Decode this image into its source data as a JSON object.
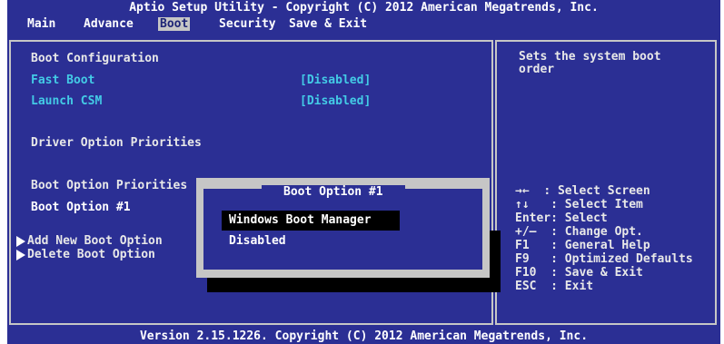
{
  "header": {
    "title": "Aptio Setup Utility - Copyright (C) 2012 American Megatrends, Inc.",
    "tabs": [
      "Main",
      "Advance",
      "Boot",
      "Security",
      "Save & Exit"
    ],
    "active_tab": "Boot"
  },
  "left_panel": {
    "boot_configuration": "Boot Configuration",
    "fast_boot": {
      "label": "Fast Boot",
      "value": "[Disabled]"
    },
    "launch_csm": {
      "label": "Launch CSM",
      "value": "[Disabled]"
    },
    "driver_option_priorities": "Driver Option Priorities",
    "boot_option_priorities": "Boot Option Priorities",
    "boot_option_1": "Boot Option #1",
    "add_new_boot_option": "Add New Boot Option",
    "delete_boot_option": "Delete Boot Option"
  },
  "popup": {
    "title": "Boot Option #1",
    "options": [
      "Windows Boot Manager",
      "Disabled"
    ],
    "selected": "Windows Boot Manager"
  },
  "right_panel": {
    "help_text": "Sets the system boot\norder",
    "keys": [
      {
        "key": "→←",
        "desc": ": Select Screen"
      },
      {
        "key": "↑↓",
        "desc": ": Select Item"
      },
      {
        "key": "Enter",
        "desc": ": Select"
      },
      {
        "key": "+/—",
        "desc": ": Change Opt."
      },
      {
        "key": "F1",
        "desc": ": General Help"
      },
      {
        "key": "F9",
        "desc": ": Optimized Defaults"
      },
      {
        "key": "F10",
        "desc": ": Save & Exit"
      },
      {
        "key": "ESC",
        "desc": ": Exit"
      }
    ]
  },
  "footer": {
    "version": "Version 2.15.1226. Copyright (C) 2012 American Megatrends, Inc."
  },
  "colors": {
    "background": "#2b2f94",
    "frame": "#c6c6c6",
    "option_text": "#43cbe6",
    "label_text": "#e8e8e8",
    "highlight": "#000000"
  }
}
